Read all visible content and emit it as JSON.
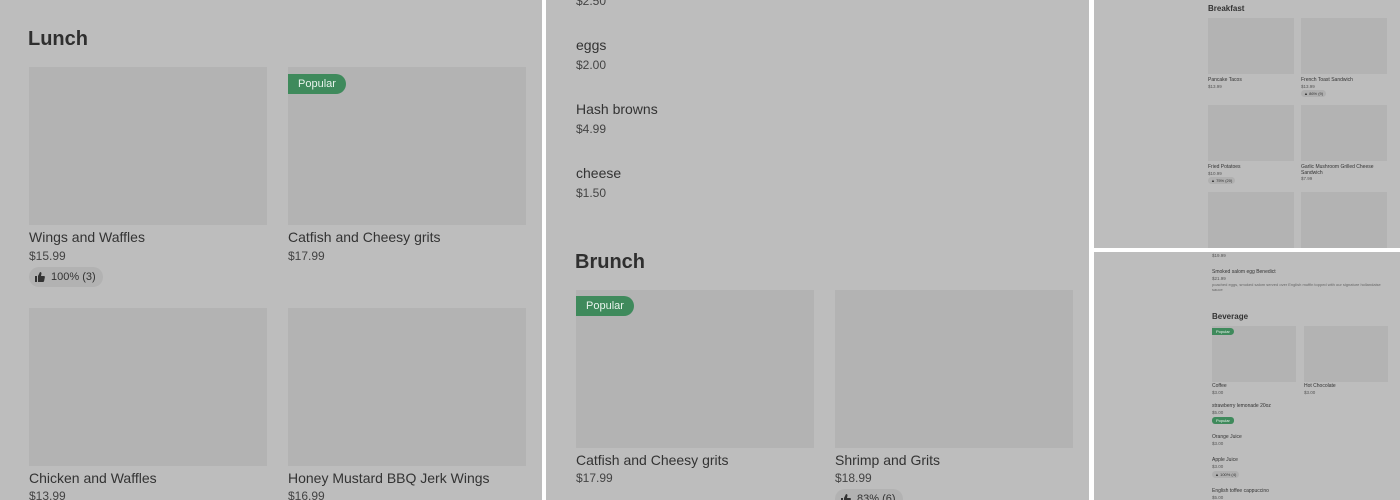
{
  "lunch": {
    "title": "Lunch",
    "items": [
      {
        "name": "Wings and Waffles",
        "price": "$15.99",
        "rating": "100% (3)"
      },
      {
        "name": "Catfish and Cheesy grits",
        "price": "$17.99",
        "badge": "Popular"
      },
      {
        "name": "Chicken and Waffles",
        "price": "$13.99"
      },
      {
        "name": "Honey Mustard BBQ Jerk Wings",
        "price": "$16.99"
      }
    ]
  },
  "sides": {
    "top_price": "$2.50",
    "items": [
      {
        "name": "eggs",
        "price": "$2.00"
      },
      {
        "name": "Hash browns",
        "price": "$4.99"
      },
      {
        "name": "cheese",
        "price": "$1.50"
      }
    ]
  },
  "brunch": {
    "title": "Brunch",
    "items": [
      {
        "name": "Catfish and Cheesy grits",
        "price": "$17.99",
        "badge": "Popular"
      },
      {
        "name": "Shrimp and Grits",
        "price": "$18.99",
        "rating": "83% (6)"
      }
    ]
  },
  "breakfast": {
    "title": "Breakfast",
    "items": [
      {
        "name": "Pancake Tacos",
        "price": "$13.99"
      },
      {
        "name": "French Toast Sandwich",
        "price": "$13.99",
        "rating": "86% (9)"
      },
      {
        "name": "Fried Potatoes",
        "price": "$10.99",
        "rating": "75% (20)"
      },
      {
        "name": "Garlic Mushroom Grilled Cheese Sandwich",
        "price": "$7.99"
      }
    ]
  },
  "beverage_panel": {
    "top_price": "$19.99",
    "benedict": {
      "name": "Smoked salom egg Benedict",
      "price": "$21.99",
      "desc": "poached eggs, smoked salom served over English muffin topped with our signature hollandaise sauce"
    },
    "title": "Beverage",
    "items": [
      {
        "name": "Coffee",
        "price": "$3.00",
        "badge": "Popular"
      },
      {
        "name": "Hot Chocolate",
        "price": "$3.00"
      }
    ],
    "list": [
      {
        "name": "strawberry lemonade 20oz",
        "price": "$5.00",
        "badge": "Popular"
      },
      {
        "name": "Orange Juice",
        "price": "$3.00"
      },
      {
        "name": "Apple Juice",
        "price": "$3.00",
        "rating": "100% (4)"
      },
      {
        "name": "English toffee cappuccino",
        "price": "$5.00"
      }
    ]
  }
}
